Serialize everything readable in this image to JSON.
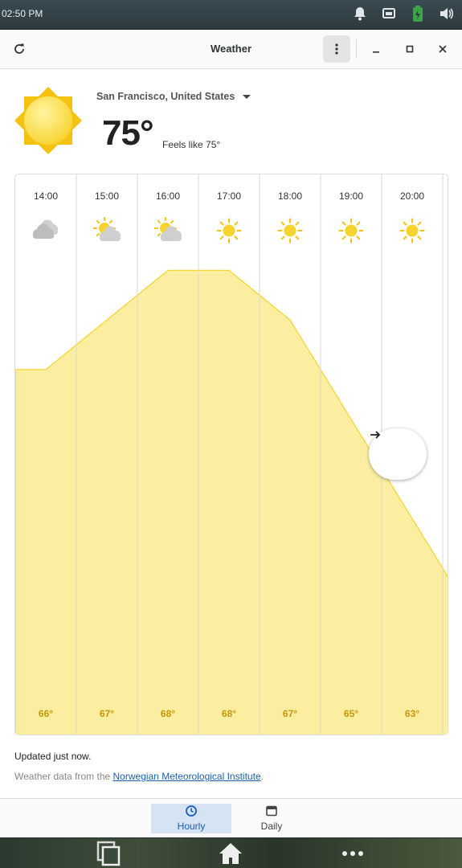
{
  "system": {
    "time": "02:50 PM",
    "icons": [
      "bell-icon",
      "network-icon",
      "battery-icon",
      "volume-icon"
    ]
  },
  "window": {
    "title": "Weather",
    "icons": [
      "refresh-icon",
      "menu-icon",
      "minimize-icon",
      "maximize-icon",
      "close-icon"
    ]
  },
  "current": {
    "location": "San Francisco, United States",
    "temperature": "75°",
    "feels_like": "Feels like 75°",
    "condition_icon": "sun-icon"
  },
  "chart_data": {
    "type": "area",
    "x": [
      "14:00",
      "15:00",
      "16:00",
      "17:00",
      "18:00",
      "19:00",
      "20:00"
    ],
    "y": [
      66,
      67,
      68,
      68,
      67,
      65,
      63
    ],
    "labels": [
      "66°",
      "67°",
      "68°",
      "68°",
      "67°",
      "65°",
      "63°"
    ],
    "conditions": [
      "cloudy",
      "partly-cloudy",
      "partly-cloudy",
      "sunny",
      "sunny",
      "sunny",
      "sunny"
    ],
    "colors": {
      "fill": "#fbeea0",
      "stroke": "#f6d32d",
      "label": "#c9960a"
    }
  },
  "footer": {
    "updated": "Updated just now.",
    "source_prefix": "Weather data from the ",
    "source_link": "Norwegian Meteorological Institute",
    "source_suffix": "."
  },
  "tabs": [
    {
      "label": "Hourly",
      "icon": "clock-icon",
      "active": true
    },
    {
      "label": "Daily",
      "icon": "calendar-icon",
      "active": false
    }
  ],
  "dock": {
    "icons": [
      "windows-icon",
      "home-icon",
      "more-icon"
    ]
  }
}
